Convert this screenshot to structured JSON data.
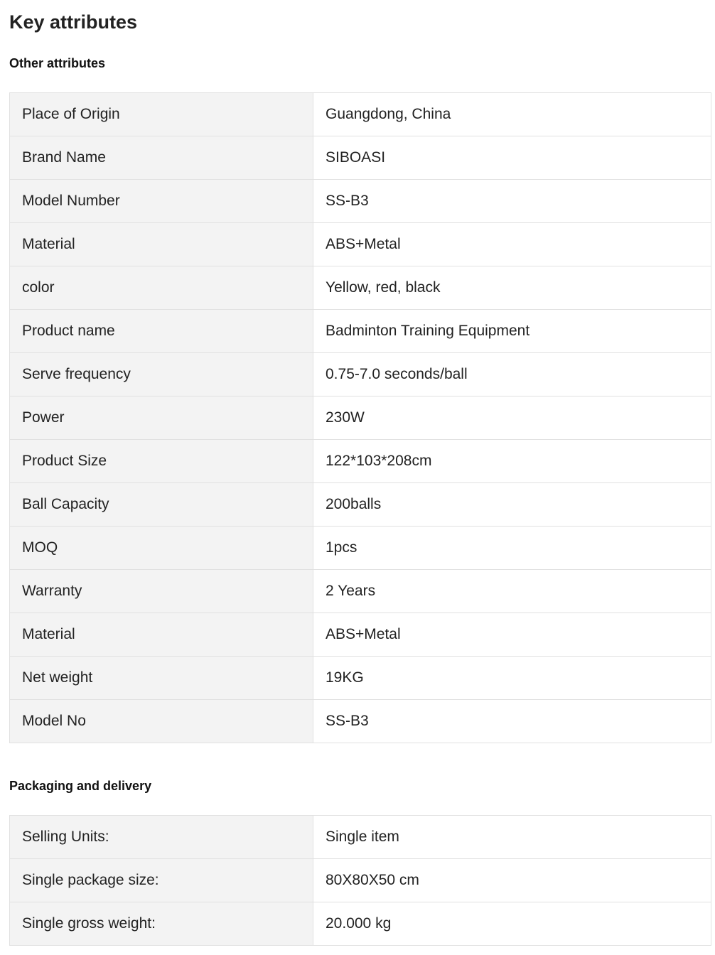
{
  "page": {
    "title": "Key attributes"
  },
  "other_attributes": {
    "title": "Other attributes",
    "rows": [
      {
        "name": "Place of Origin",
        "value": "Guangdong, China"
      },
      {
        "name": "Brand Name",
        "value": "SIBOASI"
      },
      {
        "name": "Model Number",
        "value": "SS-B3"
      },
      {
        "name": "Material",
        "value": "ABS+Metal"
      },
      {
        "name": "color",
        "value": "Yellow, red, black"
      },
      {
        "name": "Product name",
        "value": "Badminton Training Equipment"
      },
      {
        "name": "Serve frequency",
        "value": "0.75-7.0 seconds/ball"
      },
      {
        "name": "Power",
        "value": "230W"
      },
      {
        "name": "Product Size",
        "value": "122*103*208cm"
      },
      {
        "name": "Ball Capacity",
        "value": "200balls"
      },
      {
        "name": "MOQ",
        "value": "1pcs"
      },
      {
        "name": "Warranty",
        "value": "2 Years"
      },
      {
        "name": "Material",
        "value": "ABS+Metal"
      },
      {
        "name": "Net weight",
        "value": "19KG"
      },
      {
        "name": "Model No",
        "value": "SS-B3"
      }
    ]
  },
  "packaging_delivery": {
    "title": "Packaging and delivery",
    "rows": [
      {
        "name": "Selling Units:",
        "value": "Single item"
      },
      {
        "name": "Single package size:",
        "value": "80X80X50 cm"
      },
      {
        "name": "Single gross weight:",
        "value": "20.000 kg"
      }
    ]
  },
  "colors": {
    "label_cell_bg": "#f3f3f3",
    "value_cell_bg": "#ffffff",
    "border": "#e1e1e1",
    "text": "#222222"
  }
}
